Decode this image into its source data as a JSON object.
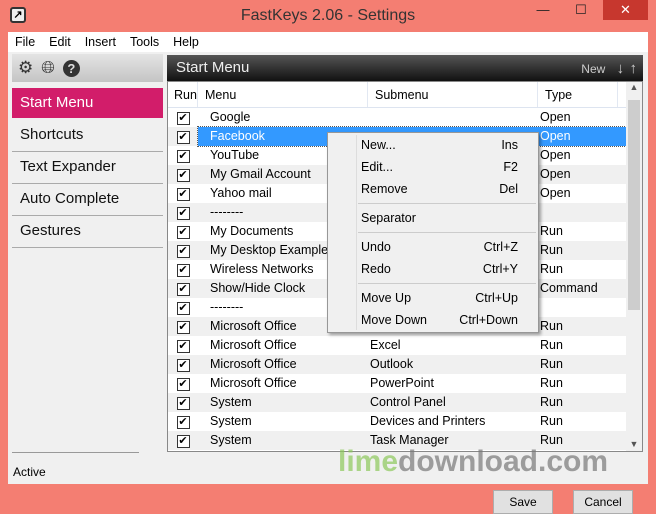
{
  "window": {
    "title": "FastKeys 2.06  - Settings",
    "close": "✕"
  },
  "menubar": [
    "File",
    "Edit",
    "Insert",
    "Tools",
    "Help"
  ],
  "sidebar": {
    "items": [
      "Start Menu",
      "Shortcuts",
      "Text Expander",
      "Auto Complete",
      "Gestures"
    ],
    "active": 0
  },
  "status": "Active",
  "panel": {
    "title": "Start Menu",
    "new_label": "New",
    "down": "↓",
    "up": "↑"
  },
  "columns": [
    "Run",
    "Menu",
    "Submenu",
    "Type"
  ],
  "rows": [
    {
      "menu": "Google",
      "sub": "",
      "type": "Open"
    },
    {
      "menu": "Facebook",
      "sub": "",
      "type": "Open"
    },
    {
      "menu": "YouTube",
      "sub": "",
      "type": "Open"
    },
    {
      "menu": "My Gmail Account",
      "sub": "",
      "type": "Open"
    },
    {
      "menu": "Yahoo mail",
      "sub": "",
      "type": "Open"
    },
    {
      "menu": "--------",
      "sub": "",
      "type": ""
    },
    {
      "menu": "My Documents",
      "sub": "",
      "type": "Run"
    },
    {
      "menu": "My Desktop Example",
      "sub": "",
      "type": "Run"
    },
    {
      "menu": "Wireless Networks",
      "sub": "",
      "type": "Run"
    },
    {
      "menu": "Show/Hide Clock",
      "sub": "",
      "type": "Command"
    },
    {
      "menu": "--------",
      "sub": "",
      "type": ""
    },
    {
      "menu": "Microsoft Office",
      "sub": "",
      "type": "Run"
    },
    {
      "menu": "Microsoft Office",
      "sub": "Excel",
      "type": "Run"
    },
    {
      "menu": "Microsoft Office",
      "sub": "Outlook",
      "type": "Run"
    },
    {
      "menu": "Microsoft Office",
      "sub": "PowerPoint",
      "type": "Run"
    },
    {
      "menu": "System",
      "sub": "Control Panel",
      "type": "Run"
    },
    {
      "menu": "System",
      "sub": "Devices and Printers",
      "type": "Run"
    },
    {
      "menu": "System",
      "sub": "Task Manager",
      "type": "Run"
    }
  ],
  "selected_row": 1,
  "context_menu": [
    {
      "label": "New...",
      "shortcut": "Ins"
    },
    {
      "label": "Edit...",
      "shortcut": "F2"
    },
    {
      "label": "Remove",
      "shortcut": "Del"
    },
    {
      "sep": true
    },
    {
      "label": "Separator",
      "shortcut": ""
    },
    {
      "sep": true
    },
    {
      "label": "Undo",
      "shortcut": "Ctrl+Z"
    },
    {
      "label": "Redo",
      "shortcut": "Ctrl+Y"
    },
    {
      "sep": true
    },
    {
      "label": "Move Up",
      "shortcut": "Ctrl+Up"
    },
    {
      "label": "Move Down",
      "shortcut": "Ctrl+Down"
    }
  ],
  "buttons": {
    "save": "Save",
    "cancel": "Cancel"
  },
  "watermark": {
    "a": "lime",
    "b": "download.com"
  },
  "colors": {
    "accent": "#d21d6a",
    "selection": "#3399ff",
    "frame": "#f47e72"
  }
}
